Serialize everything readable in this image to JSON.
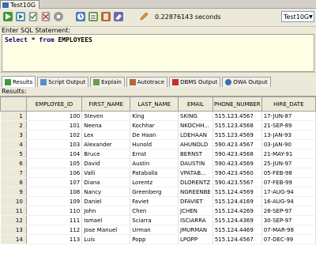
{
  "connection_tab": {
    "label": "Test10G"
  },
  "toolbar": {
    "elapsed_value": "0.22876143",
    "elapsed_unit": "seconds",
    "connection": "Test10G"
  },
  "sql": {
    "label": "Enter SQL Statement:",
    "statement_kw1": "Select",
    "statement_star": "*",
    "statement_kw2": "from",
    "statement_table": "EMPLOYEES"
  },
  "output_tabs": [
    {
      "label": "Results",
      "icon": "results-icon"
    },
    {
      "label": "Script Output",
      "icon": "script-icon"
    },
    {
      "label": "Explain",
      "icon": "explain-icon"
    },
    {
      "label": "Autotrace",
      "icon": "autotrace-icon"
    },
    {
      "label": "DBMS Output",
      "icon": "dbms-icon"
    },
    {
      "label": "OWA Output",
      "icon": "owa-icon"
    }
  ],
  "results_label": "Results:",
  "columns": [
    "EMPLOYEE_ID",
    "FIRST_NAME",
    "LAST_NAME",
    "EMAIL",
    "PHONE_NUMBER",
    "HIRE_DATE"
  ],
  "rows": [
    [
      "1",
      "100",
      "Steven",
      "King",
      "SKING",
      "515.123.4567",
      "17-JUN-87"
    ],
    [
      "2",
      "101",
      "Neena",
      "Kochhar",
      "NKOCHH...",
      "515.123.4568",
      "21-SEP-89"
    ],
    [
      "3",
      "102",
      "Lex",
      "De Haan",
      "LDEHAAN",
      "515.123.4569",
      "13-JAN-93"
    ],
    [
      "4",
      "103",
      "Alexander",
      "Hunold",
      "AHUNOLD",
      "590.423.4567",
      "03-JAN-90"
    ],
    [
      "5",
      "104",
      "Bruce",
      "Ernst",
      "BERNST",
      "590.423.4568",
      "21-MAY-91"
    ],
    [
      "6",
      "105",
      "David",
      "Austin",
      "DAUSTIN",
      "590.423.4569",
      "25-JUN-97"
    ],
    [
      "7",
      "106",
      "Valli",
      "Pataballa",
      "VPATAB...",
      "590.423.4560",
      "05-FEB-98"
    ],
    [
      "8",
      "107",
      "Diana",
      "Lorentz",
      "DLORENTZ",
      "590.423.5567",
      "07-FEB-99"
    ],
    [
      "9",
      "108",
      "Nancy",
      "Greenberg",
      "NGREENBE",
      "515.124.4569",
      "17-AUG-94"
    ],
    [
      "10",
      "109",
      "Daniel",
      "Faviet",
      "DFAVIET",
      "515.124.4169",
      "16-AUG-94"
    ],
    [
      "11",
      "110",
      "John",
      "Chen",
      "JCHEN",
      "515.124.4269",
      "28-SEP-97"
    ],
    [
      "12",
      "111",
      "Ismael",
      "Sciarra",
      "ISCIARRA",
      "515.124.4369",
      "30-SEP-97"
    ],
    [
      "13",
      "112",
      "Jose Manuel",
      "Urman",
      "JMURMAN",
      "515.124.4469",
      "07-MAR-98"
    ],
    [
      "14",
      "113",
      "Luis",
      "Popp",
      "LPOPP",
      "515.124.4567",
      "07-DEC-99"
    ]
  ]
}
